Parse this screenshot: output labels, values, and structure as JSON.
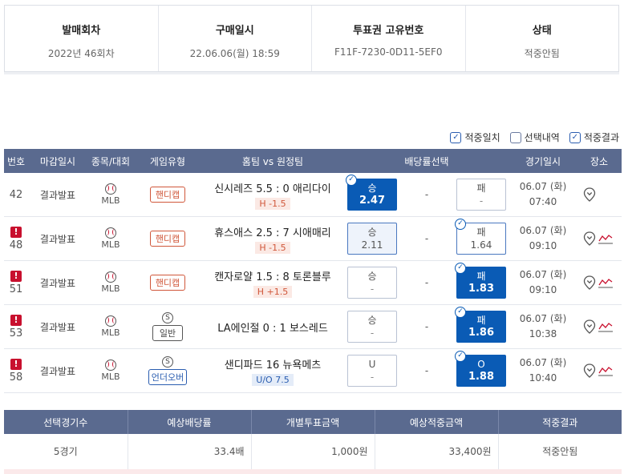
{
  "ticket": {
    "round_label": "발매회차",
    "round_value": "2022년 46회차",
    "purchase_label": "구매일시",
    "purchase_value": "22.06.06(월) 18:59",
    "id_label": "투표권 고유번호",
    "id_value": "F11F-7230-0D11-5EF0",
    "status_label": "상태",
    "status_value": "적중안됨"
  },
  "legend": {
    "hit": "적중일치",
    "selection": "선택내역",
    "result": "적중결과"
  },
  "headers": {
    "no": "번호",
    "close": "마감일시",
    "sport": "종목/대회",
    "type": "게임유형",
    "match": "홈팀 vs 원정팀",
    "odds": "배당률선택",
    "time": "경기일시",
    "venue": "장소"
  },
  "rows": [
    {
      "no": "42",
      "alert": "",
      "close": "결과발표",
      "league": "MLB",
      "type": "핸디캡",
      "s": "",
      "match": "신시레즈 5.5 : 0 애리다이",
      "handicap": "H -1.5",
      "uo": "",
      "left_label": "승",
      "left_value": "2.47",
      "mid": "-",
      "right_label": "패",
      "right_value": "-",
      "date": "06.07 (화)",
      "hour": "07:40"
    },
    {
      "no": "48",
      "alert": "!",
      "close": "결과발표",
      "league": "MLB",
      "type": "핸디캡",
      "s": "",
      "match": "휴스애스 2.5 : 7 시애매리",
      "handicap": "H -1.5",
      "uo": "",
      "left_label": "승",
      "left_value": "2.11",
      "mid": "-",
      "right_label": "패",
      "right_value": "1.64",
      "date": "06.07 (화)",
      "hour": "09:10"
    },
    {
      "no": "51",
      "alert": "!",
      "close": "결과발표",
      "league": "MLB",
      "type": "핸디캡",
      "s": "",
      "match": "캔자로얄 1.5 : 8 토론블루",
      "handicap": "H +1.5",
      "uo": "",
      "left_label": "승",
      "left_value": "-",
      "mid": "-",
      "right_label": "패",
      "right_value": "1.83",
      "date": "06.07 (화)",
      "hour": "09:10"
    },
    {
      "no": "53",
      "alert": "!",
      "close": "결과발표",
      "league": "MLB",
      "type": "일반",
      "s": "S",
      "match": "LA에인절 0 : 1 보스레드",
      "handicap": "",
      "uo": "",
      "left_label": "승",
      "left_value": "-",
      "mid": "-",
      "right_label": "패",
      "right_value": "1.86",
      "date": "06.07 (화)",
      "hour": "10:38"
    },
    {
      "no": "58",
      "alert": "!",
      "close": "결과발표",
      "league": "MLB",
      "type": "언더오버",
      "s": "S",
      "match": "샌디파드   16   뉴욕메츠",
      "handicap": "",
      "uo": "U/O 7.5",
      "left_label": "U",
      "left_value": "-",
      "mid": "-",
      "right_label": "O",
      "right_value": "1.88",
      "date": "06.07 (화)",
      "hour": "10:40"
    }
  ],
  "summary": {
    "h_games": "선택경기수",
    "h_odds": "예상배당률",
    "h_bet": "개별투표금액",
    "h_win": "예상적중금액",
    "h_result": "적중결과",
    "games": "5경기",
    "odds": "33.4배",
    "bet": "1,000원",
    "win": "33,400원",
    "result": "적중안됨"
  },
  "colors": {
    "header_bg": "#5a6a8f",
    "selected_blue": "#0a5bb5",
    "alert_red": "#c8102e",
    "handicap_orange": "#d0573a"
  }
}
